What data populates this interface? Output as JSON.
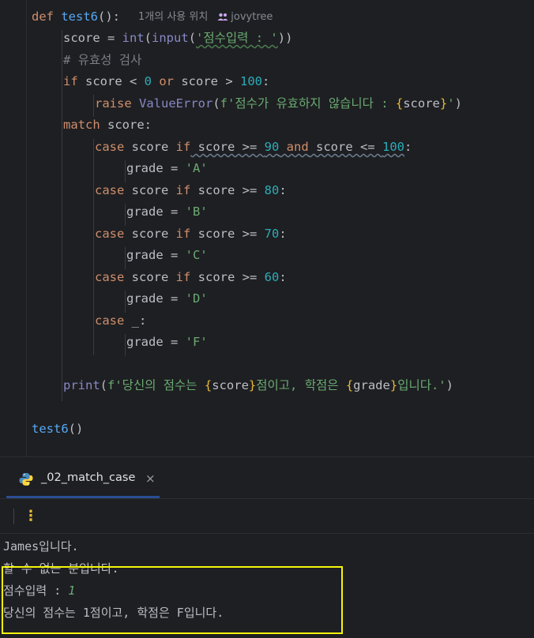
{
  "editor": {
    "inlay_hint": {
      "usages": "1개의 사용 위치",
      "author": "jovytree"
    },
    "lines": {
      "l1": {
        "def": "def",
        "name": "test6",
        "paren": "():"
      },
      "l2": {
        "var": "score",
        "eq": " = ",
        "int": "int",
        "open": "(",
        "input": "input",
        "open2": "(",
        "str": "'점수입력 : '",
        "close": "))"
      },
      "l3": {
        "comment": "# 유효성 검사"
      },
      "l4": {
        "if": "if",
        "rest1": " score < ",
        "n0": "0",
        "or": " or",
        "rest2": " score > ",
        "n100": "100",
        "colon": ":"
      },
      "l5": {
        "raise": "raise",
        "cls": " ValueError",
        "open": "(",
        "fpre": "f'점수가 유효하지 않습니다 : ",
        "b1": "{",
        "var": "score",
        "b2": "}",
        "fend": "'",
        "close": ")"
      },
      "l6": {
        "match": "match",
        "rest": " score:"
      },
      "l7": {
        "case": "case",
        "v": " score ",
        "if": "if",
        "cond1": " score >= ",
        "n1": "90",
        "and": " and",
        "cond2": " score <= ",
        "n2": "100",
        "colon": ":"
      },
      "l8": {
        "var": "grade = ",
        "str": "'A'"
      },
      "l9": {
        "case": "case",
        "v": " score ",
        "if": "if",
        "cond": " score >= ",
        "n": "80",
        "colon": ":"
      },
      "l10": {
        "var": "grade = ",
        "str": "'B'"
      },
      "l11": {
        "case": "case",
        "v": " score ",
        "if": "if",
        "cond": " score >= ",
        "n": "70",
        "colon": ":"
      },
      "l12": {
        "var": "grade = ",
        "str": "'C'"
      },
      "l13": {
        "case": "case",
        "v": " score ",
        "if": "if",
        "cond": " score >= ",
        "n": "60",
        "colon": ":"
      },
      "l14": {
        "var": "grade = ",
        "str": "'D'"
      },
      "l15": {
        "case": "case",
        "rest": " _:"
      },
      "l16": {
        "var": "grade = ",
        "str": "'F'"
      },
      "l17": {
        "print": "print",
        "open": "(",
        "f1": "f'당신의 점수는 ",
        "b1": "{",
        "v1": "score",
        "b2": "}",
        "f2": "점이고, 학점은 ",
        "b3": "{",
        "v2": "grade",
        "b4": "}",
        "f3": "입니다.'",
        "close": ")"
      },
      "l18": {
        "call": "test6",
        "paren": "()"
      }
    }
  },
  "run_panel": {
    "tab_label": "_02_match_case",
    "tab_close": "×",
    "more_icon": "⋮",
    "console": {
      "line1": "James입니다.",
      "line2": "할 수 없는 분입니다.",
      "line3_prompt": "점수입력 : ",
      "line3_input": "1",
      "line4": "당신의 점수는 1점이고, 학점은 F입니다."
    }
  },
  "colors": {
    "highlight_box": "#f5f50a",
    "keyword": "#cf8e6d",
    "function": "#56a8f5",
    "string": "#6aab73",
    "number": "#2aacb8"
  }
}
